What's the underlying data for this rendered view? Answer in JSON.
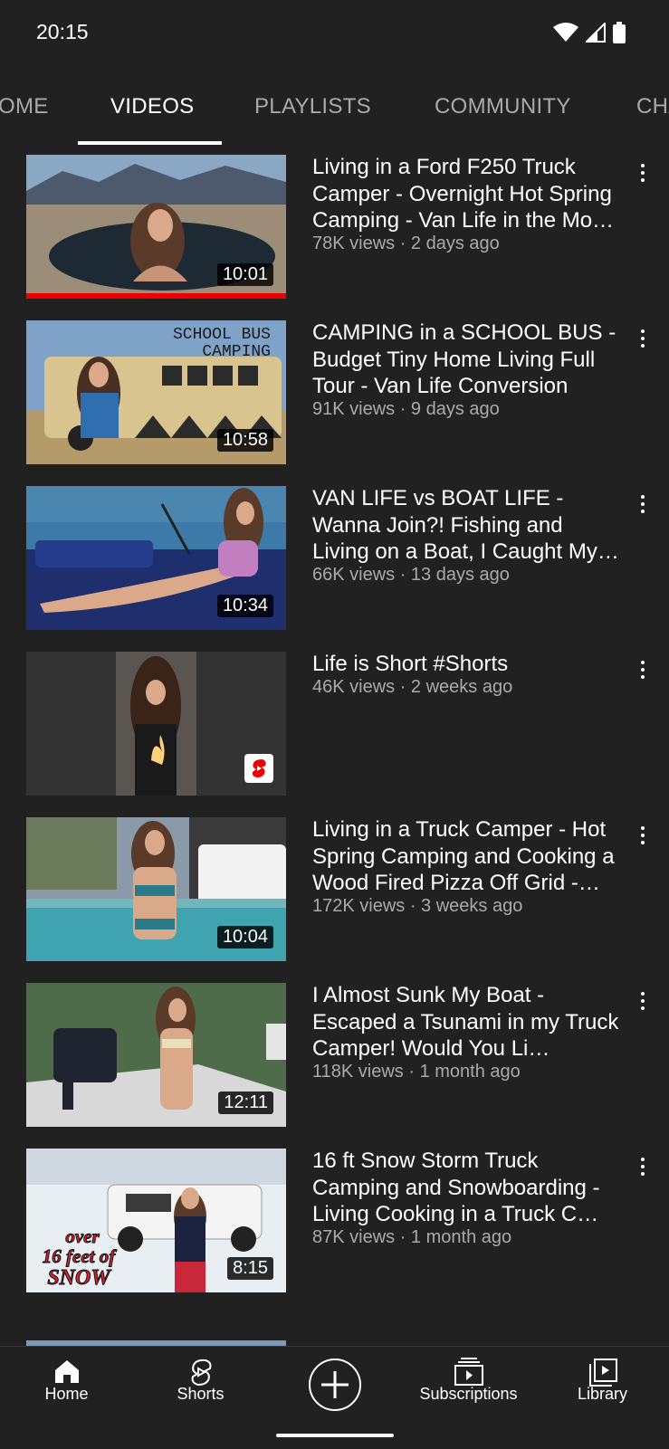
{
  "status_bar": {
    "time": "20:15"
  },
  "tabs": [
    {
      "label": "HOME",
      "visible_text": "OME",
      "active": false
    },
    {
      "label": "VIDEOS",
      "visible_text": "VIDEOS",
      "active": true
    },
    {
      "label": "PLAYLISTS",
      "visible_text": "PLAYLISTS",
      "active": false
    },
    {
      "label": "COMMUNITY",
      "visible_text": "COMMUNITY",
      "active": false
    },
    {
      "label": "CHANNELS",
      "visible_text": "CHA",
      "active": false
    }
  ],
  "videos": [
    {
      "title": "Living in a Ford F250 Truck Camper - Overnight Hot Spring Camping - Van Life in the Mo…",
      "meta": "78K views · 2 days ago",
      "duration": "10:01",
      "watched_fraction": 1.0
    },
    {
      "title": "CAMPING in a SCHOOL BUS - Budget Tiny Home Living Full Tour - Van Life Conversion",
      "meta": "91K views · 9 days ago",
      "duration": "10:58",
      "thumb_caption": "SCHOOL BUS CAMPING"
    },
    {
      "title": "VAN LIFE vs BOAT LIFE - Wanna Join?! Fishing and Living on a Boat, I Caught My…",
      "meta": "66K views · 13 days ago",
      "duration": "10:34"
    },
    {
      "title": "Life is Short #Shorts",
      "meta": "46K views · 2 weeks ago",
      "is_short": true
    },
    {
      "title": "Living in a Truck Camper - Hot Spring Camping and Cooking a Wood Fired Pizza Off Grid -…",
      "meta": "172K views · 3 weeks ago",
      "duration": "10:04"
    },
    {
      "title": "I Almost Sunk My Boat - Escaped a Tsunami in my Truck Camper! Would You Li…",
      "meta": "118K views · 1 month ago",
      "duration": "12:11"
    },
    {
      "title": "16 ft Snow Storm Truck Camping and Snowboarding - Living Cooking in a Truck C…",
      "meta": "87K views · 1 month ago",
      "duration": "8:15",
      "thumb_caption": "over 16 feet of SNOW"
    }
  ],
  "bottom_nav": {
    "home": "Home",
    "shorts": "Shorts",
    "create": "",
    "subscriptions": "Subscriptions",
    "library": "Library"
  },
  "icons": [
    "wifi-icon",
    "signal-icon",
    "battery-icon",
    "more-vert-icon",
    "home-icon",
    "shorts-icon",
    "create-icon",
    "subscriptions-icon",
    "library-icon"
  ],
  "colors": {
    "background": "#212121",
    "text": "#ffffff",
    "secondary_text": "#aaaaaa",
    "progress": "#ee0000"
  }
}
